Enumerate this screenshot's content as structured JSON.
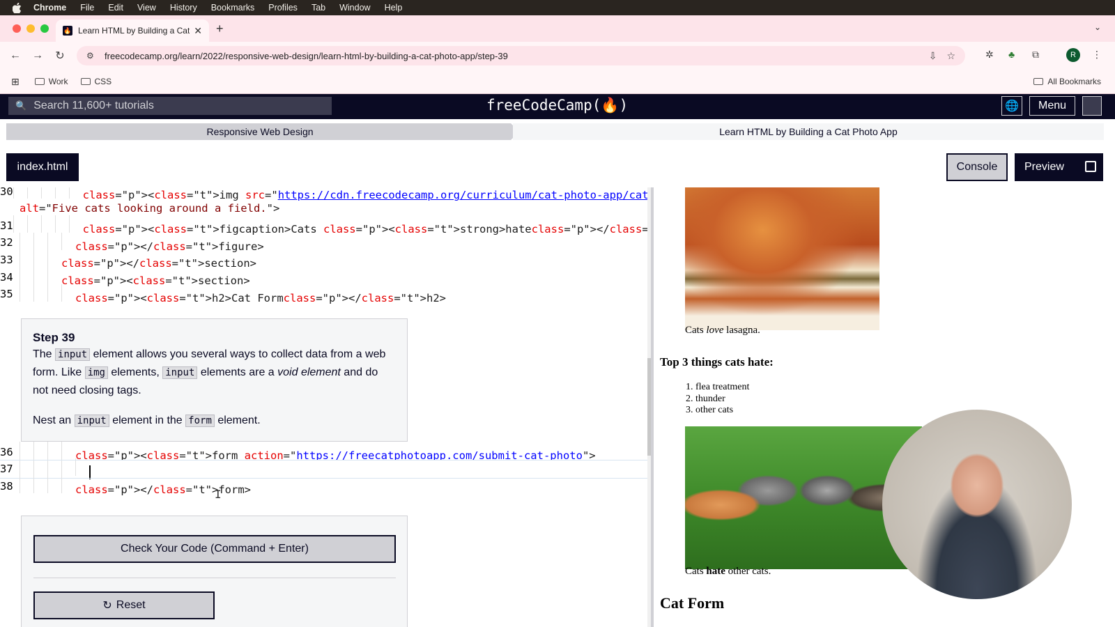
{
  "menubar": {
    "app": "Chrome",
    "items": [
      "File",
      "Edit",
      "View",
      "History",
      "Bookmarks",
      "Profiles",
      "Tab",
      "Window",
      "Help"
    ]
  },
  "browser": {
    "tab_title": "Learn HTML by Building a Cat",
    "url": "freecodecamp.org/learn/2022/responsive-web-design/learn-html-by-building-a-cat-photo-app/step-39",
    "bookmarks": [
      "Work",
      "CSS"
    ],
    "all_bookmarks": "All Bookmarks",
    "profile_initial": "R"
  },
  "fcc": {
    "search_placeholder": "Search 11,600+ tutorials",
    "logo": "freeCodeCamp(🔥)",
    "menu_label": "Menu",
    "breadcrumb_course": "Responsive Web Design",
    "breadcrumb_project": "Learn HTML by Building a Cat Photo App"
  },
  "toolbar": {
    "file_tab": "index.html",
    "console_label": "Console",
    "preview_label": "Preview"
  },
  "code_top": [
    {
      "num": "30",
      "indent": 5,
      "html": "<img src=\"https://cdn.freecodecamp.org/curriculum/cat-photo-app/cats.jpg\""
    },
    {
      "num": "",
      "indent": 0,
      "html": "alt=\"Five cats looking around a field.\">"
    },
    {
      "num": "31",
      "indent": 5,
      "html": "<figcaption>Cats <strong>hate</strong> other cats.</figcaption>"
    },
    {
      "num": "32",
      "indent": 4,
      "html": "</figure>"
    },
    {
      "num": "33",
      "indent": 3,
      "html": "</section>"
    },
    {
      "num": "34",
      "indent": 3,
      "html": "<section>"
    },
    {
      "num": "35",
      "indent": 4,
      "html": "<h2>Cat Form</h2>"
    }
  ],
  "code_bottom": [
    {
      "num": "36",
      "indent": 4,
      "html": "<form action=\"https://freecatphotoapp.com/submit-cat-photo\">"
    },
    {
      "num": "37",
      "indent": 5,
      "html": ""
    },
    {
      "num": "38",
      "indent": 4,
      "html": "</form>"
    }
  ],
  "step": {
    "title": "Step 39",
    "p1_a": "The ",
    "p1_code1": "input",
    "p1_b": " element allows you several ways to collect data from a web form. Like ",
    "p1_code2": "img",
    "p1_c": " elements, ",
    "p1_code3": "input",
    "p1_d": " elements are a ",
    "p1_em": "void element",
    "p1_e": " and do not need closing tags.",
    "p2_a": "Nest an ",
    "p2_code1": "input",
    "p2_b": " element in the ",
    "p2_code2": "form",
    "p2_c": " element."
  },
  "actions": {
    "check_label": "Check Your Code (Command + Enter)",
    "reset_label": "Reset"
  },
  "preview": {
    "lasagna_caption_a": "Cats ",
    "lasagna_caption_em": "love",
    "lasagna_caption_b": " lasagna.",
    "hate_heading": "Top 3 things cats hate:",
    "hate_items": [
      "flea treatment",
      "thunder",
      "other cats"
    ],
    "kittens_caption_a": "Cats ",
    "kittens_caption_strong": "hate",
    "kittens_caption_b": " other cats.",
    "form_heading": "Cat Form"
  }
}
